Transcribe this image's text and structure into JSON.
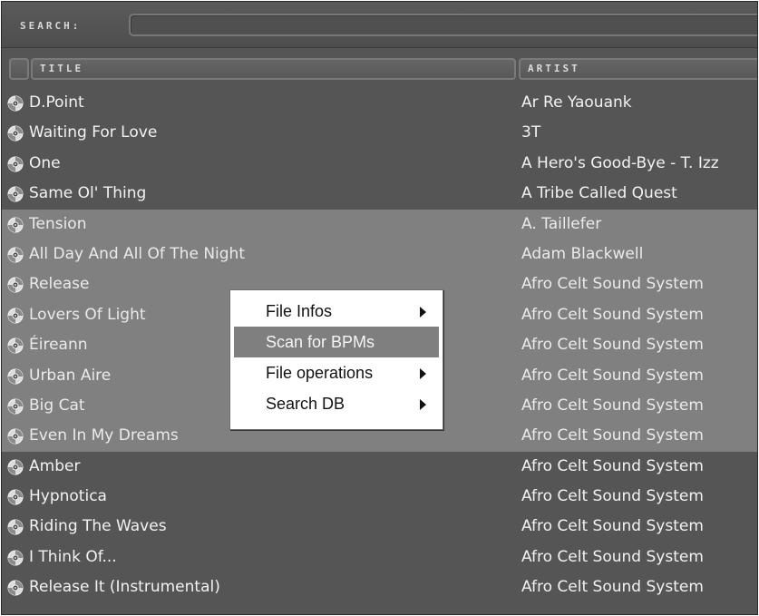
{
  "search": {
    "label": "SEARCH:",
    "value": ""
  },
  "columns": {
    "title": "TITLE",
    "artist": "ARTIST"
  },
  "tracks": [
    {
      "icon": "cd-icon",
      "title": "D.Point",
      "artist": "Ar Re Yaouank",
      "highlighted": false
    },
    {
      "icon": "cd-icon",
      "title": "Waiting For Love",
      "artist": "3T",
      "highlighted": false
    },
    {
      "icon": "cd-icon",
      "title": "One",
      "artist": "A Hero's Good-Bye - T. Izz",
      "highlighted": false
    },
    {
      "icon": "cd-icon",
      "title": "Same Ol' Thing",
      "artist": "A Tribe Called Quest",
      "highlighted": false
    },
    {
      "icon": "cd-icon",
      "title": "Tension",
      "artist": "A. Taillefer",
      "highlighted": true
    },
    {
      "icon": "cd-icon",
      "title": "All Day And All Of The Night",
      "artist": "Adam Blackwell",
      "highlighted": true
    },
    {
      "icon": "cd-icon",
      "title": "Release",
      "artist": "Afro Celt Sound System",
      "highlighted": true
    },
    {
      "icon": "cd-icon",
      "title": "Lovers Of Light",
      "artist": "Afro Celt Sound System",
      "highlighted": true
    },
    {
      "icon": "cd-icon",
      "title": "Éireann",
      "artist": "Afro Celt Sound System",
      "highlighted": true
    },
    {
      "icon": "cd-icon",
      "title": "Urban Aire",
      "artist": "Afro Celt Sound System",
      "highlighted": true
    },
    {
      "icon": "cd-icon",
      "title": "Big Cat",
      "artist": "Afro Celt Sound System",
      "highlighted": true
    },
    {
      "icon": "cd-icon",
      "title": "Even In My Dreams",
      "artist": "Afro Celt Sound System",
      "highlighted": true
    },
    {
      "icon": "cd-icon",
      "title": "Amber",
      "artist": "Afro Celt Sound System",
      "highlighted": false
    },
    {
      "icon": "cd-icon",
      "title": "Hypnotica",
      "artist": "Afro Celt Sound System",
      "highlighted": false
    },
    {
      "icon": "cd-icon",
      "title": "Riding The Waves",
      "artist": "Afro Celt Sound System",
      "highlighted": false
    },
    {
      "icon": "cd-icon",
      "title": "I Think Of...",
      "artist": "Afro Celt Sound System",
      "highlighted": false
    },
    {
      "icon": "cd-icon",
      "title": "Release It (Instrumental)",
      "artist": "Afro Celt Sound System",
      "highlighted": false
    }
  ],
  "context_menu": {
    "items": [
      {
        "label": "File Infos",
        "submenu": true,
        "highlighted": false
      },
      {
        "label": "Scan for BPMs",
        "submenu": false,
        "highlighted": true
      },
      {
        "label": "File operations",
        "submenu": true,
        "highlighted": false
      },
      {
        "label": "Search DB",
        "submenu": true,
        "highlighted": false
      }
    ]
  },
  "colors": {
    "background": "#555555",
    "highlight_band": "#808080",
    "menu_highlight": "#7f7f7f",
    "text": "#f2f2f2"
  }
}
